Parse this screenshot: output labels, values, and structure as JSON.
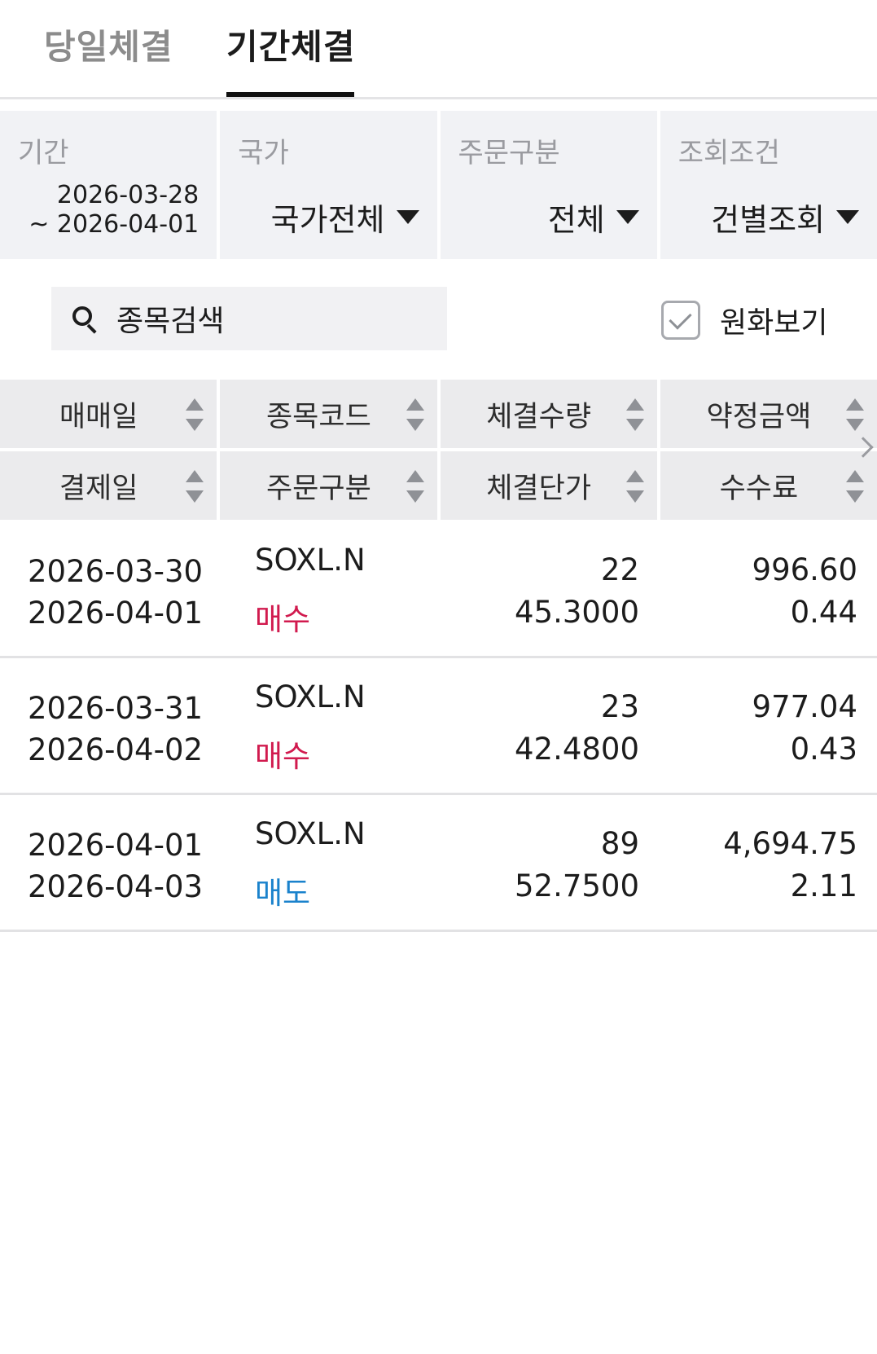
{
  "tabs": {
    "today": "당일체결",
    "period": "기간체결"
  },
  "filters": {
    "period": {
      "label": "기간",
      "from": "2026-03-28",
      "to": "~ 2026-04-01"
    },
    "country": {
      "label": "국가",
      "value": "국가전체"
    },
    "order_type": {
      "label": "주문구분",
      "value": "전체"
    },
    "query": {
      "label": "조회조건",
      "value": "건별조회"
    }
  },
  "search": {
    "placeholder": "종목검색"
  },
  "krw_toggle": {
    "label": "원화보기",
    "checked": true
  },
  "headers": {
    "row1": [
      "매매일",
      "종목코드",
      "체결수량",
      "약정금액"
    ],
    "row2": [
      "결제일",
      "주문구분",
      "체결단가",
      "수수료"
    ]
  },
  "rows": [
    {
      "trade_date": "2026-03-30",
      "settle_date": "2026-04-01",
      "code": "SOXL.N",
      "side": "매수",
      "qty": "22",
      "price": "45.3000",
      "amount": "996.60",
      "fee": "0.44"
    },
    {
      "trade_date": "2026-03-31",
      "settle_date": "2026-04-02",
      "code": "SOXL.N",
      "side": "매수",
      "qty": "23",
      "price": "42.4800",
      "amount": "977.04",
      "fee": "0.43"
    },
    {
      "trade_date": "2026-04-01",
      "settle_date": "2026-04-03",
      "code": "SOXL.N",
      "side": "매도",
      "qty": "89",
      "price": "52.7500",
      "amount": "4,694.75",
      "fee": "2.11"
    }
  ],
  "colors": {
    "buy": "#d11a4e",
    "sell": "#1a82cc",
    "header_bg": "#ebebed",
    "filter_bg": "#f1f2f5"
  }
}
